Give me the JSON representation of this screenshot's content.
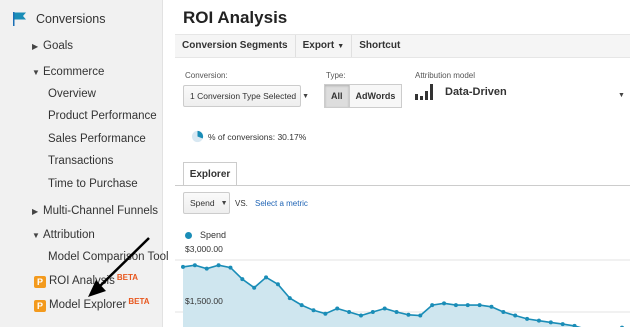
{
  "sidebar": {
    "header": "Conversions",
    "items": [
      {
        "label": "Goals",
        "caret": "▶"
      },
      {
        "label": "Ecommerce",
        "caret": "▼"
      },
      {
        "label": "Overview"
      },
      {
        "label": "Product Performance"
      },
      {
        "label": "Sales Performance"
      },
      {
        "label": "Transactions"
      },
      {
        "label": "Time to Purchase"
      },
      {
        "label": "Multi-Channel Funnels",
        "caret": "▶"
      },
      {
        "label": "Attribution",
        "caret": "▼"
      },
      {
        "label": "Model Comparison Tool"
      },
      {
        "label": "ROI Analysis",
        "badge": "P",
        "beta": "BETA"
      },
      {
        "label": "Model Explorer",
        "badge": "P",
        "beta": "BETA"
      }
    ]
  },
  "main": {
    "title": "ROI Analysis",
    "toolbar": {
      "conversion_segments": "Conversion Segments",
      "export": "Export",
      "shortcut": "Shortcut"
    },
    "conversion": {
      "label": "Conversion:",
      "value": "1 Conversion Type Selected"
    },
    "type": {
      "label": "Type:",
      "options": [
        "All",
        "AdWords"
      ],
      "active": "All"
    },
    "attribution": {
      "label": "Attribution model",
      "value": "Data-Driven"
    },
    "pct_conversions": "% of conversions: 30.17%",
    "tab": "Explorer",
    "metric": {
      "selected": "Spend",
      "vs": "VS.",
      "select_link": "Select a metric"
    },
    "legend": "Spend"
  },
  "colors": {
    "accent": "#1a8db7",
    "area_fill": "#cfe6ef",
    "link": "#1f64b5",
    "badge": "#f39a1d",
    "beta": "#e8571e"
  },
  "chart_data": {
    "type": "area",
    "series": [
      {
        "name": "Spend",
        "values": [
          2800,
          2850,
          2750,
          2850,
          2780,
          2450,
          2200,
          2500,
          2300,
          1900,
          1700,
          1550,
          1450,
          1600,
          1500,
          1400,
          1500,
          1600,
          1500,
          1420,
          1400,
          1700,
          1750,
          1700,
          1700,
          1700,
          1650,
          1500,
          1400,
          1300,
          1250,
          1200,
          1150,
          1100,
          1000,
          950,
          1000,
          1050
        ]
      }
    ],
    "yticks": [
      "$3,000.00",
      "$1,500.00"
    ],
    "ylim": [
      900,
      3000
    ],
    "grid": true
  }
}
